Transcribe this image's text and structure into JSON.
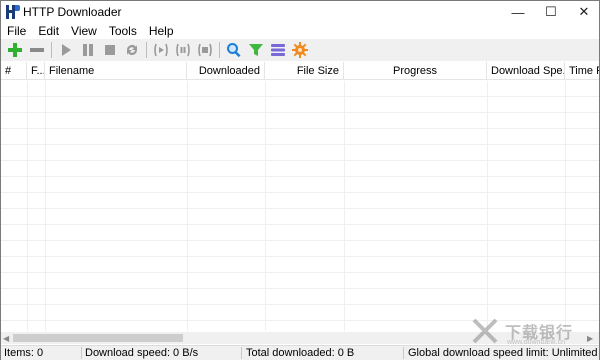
{
  "window": {
    "title": "HTTP Downloader",
    "controls": {
      "minimize": "—",
      "maximize": "☐",
      "close": "✕"
    }
  },
  "menu": [
    "File",
    "Edit",
    "View",
    "Tools",
    "Help"
  ],
  "toolbar": {
    "buttons": [
      {
        "name": "add-download",
        "icon": "plus-icon",
        "color": "#2fb12f"
      },
      {
        "name": "remove-download",
        "icon": "minus-icon",
        "color": "#8a8a8a"
      },
      {
        "name": "start",
        "icon": "play-icon",
        "color": "#9a9a9a"
      },
      {
        "name": "pause",
        "icon": "pause-icon",
        "color": "#9a9a9a"
      },
      {
        "name": "stop",
        "icon": "stop-icon",
        "color": "#9a9a9a"
      },
      {
        "name": "restart",
        "icon": "refresh-icon",
        "color": "#9a9a9a"
      },
      {
        "name": "start-all",
        "icon": "start-all-icon",
        "color": "#9a9a9a"
      },
      {
        "name": "pause-all",
        "icon": "pause-all-icon",
        "color": "#9a9a9a"
      },
      {
        "name": "stop-all",
        "icon": "stop-all-icon",
        "color": "#9a9a9a"
      },
      {
        "name": "search",
        "icon": "search-icon",
        "color": "#1e7fd8"
      },
      {
        "name": "filter",
        "icon": "filter-icon",
        "color": "#3fb83f"
      },
      {
        "name": "site-manager",
        "icon": "list-icon",
        "color": "#7868d8"
      },
      {
        "name": "options",
        "icon": "gear-icon",
        "color": "#f08a1e"
      }
    ]
  },
  "columns": [
    {
      "label": "#"
    },
    {
      "label": "F..."
    },
    {
      "label": "Filename"
    },
    {
      "label": "Downloaded"
    },
    {
      "label": "File Size"
    },
    {
      "label": "Progress"
    },
    {
      "label": "Download Spe..."
    },
    {
      "label": "Time Re..."
    }
  ],
  "status": {
    "items": "Items: 0",
    "download_speed": "Download speed: 0 B/s",
    "total_downloaded": "Total downloaded: 0 B",
    "speed_limit": "Global download speed limit: Unlimited"
  },
  "watermark": {
    "text": "下载银行",
    "url": "www.downbank.cn"
  }
}
